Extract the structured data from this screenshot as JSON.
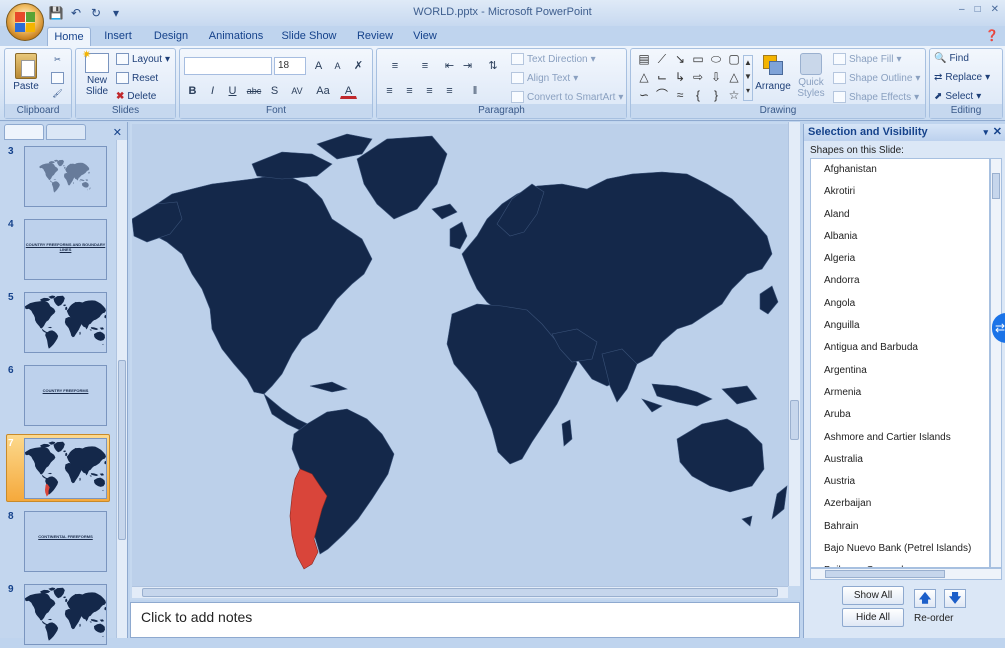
{
  "window": {
    "title": "WORLD.pptx - Microsoft PowerPoint"
  },
  "tabs": [
    "Home",
    "Insert",
    "Design",
    "Animations",
    "Slide Show",
    "Review",
    "View"
  ],
  "ribbon": {
    "clipboard": {
      "label": "Clipboard",
      "paste": "Paste"
    },
    "slides": {
      "label": "Slides",
      "new_slide": "New Slide",
      "new_slide_l1": "New",
      "new_slide_l2": "Slide",
      "layout": "Layout",
      "reset": "Reset",
      "delete": "Delete"
    },
    "font": {
      "label": "Font",
      "font_name": "",
      "font_size": "18",
      "bold": "B",
      "italic": "I",
      "underline": "U",
      "strike": "abc",
      "shadow": "S",
      "spacing": "AV",
      "case": "Aa",
      "color": "A",
      "grow": "A",
      "shrink": "A"
    },
    "paragraph": {
      "label": "Paragraph",
      "text_direction": "Text Direction",
      "align_text": "Align Text",
      "convert_smartart": "Convert to SmartArt"
    },
    "drawing": {
      "label": "Drawing",
      "arrange": "Arrange",
      "quick_styles": "Quick Styles",
      "quick_styles_l1": "Quick",
      "quick_styles_l2": "Styles",
      "shape_fill": "Shape Fill",
      "shape_outline": "Shape Outline",
      "shape_effects": "Shape Effects"
    },
    "editing": {
      "label": "Editing",
      "find": "Find",
      "replace": "Replace",
      "select": "Select"
    }
  },
  "slides_panel": {
    "thumbnails": [
      {
        "num": "3",
        "type": "map-small",
        "text": "",
        "selected": false
      },
      {
        "num": "4",
        "type": "text",
        "text": "COUNTRY FREEFORMS AND BOUNDARY LINES",
        "selected": false
      },
      {
        "num": "5",
        "type": "map",
        "text": "",
        "selected": false
      },
      {
        "num": "6",
        "type": "text",
        "text": "COUNTRY FREEFORMS",
        "selected": false
      },
      {
        "num": "7",
        "type": "map-highlight",
        "text": "",
        "selected": true
      },
      {
        "num": "8",
        "type": "text",
        "text": "CONTINENTAL FREEFORMS",
        "selected": false
      },
      {
        "num": "9",
        "type": "map",
        "text": "",
        "selected": false
      }
    ]
  },
  "notes": {
    "placeholder": "Click to add notes"
  },
  "selection_pane": {
    "title": "Selection and Visibility",
    "subtitle": "Shapes on this Slide:",
    "items": [
      "Afghanistan",
      "Akrotiri",
      "Aland",
      "Albania",
      "Algeria",
      "Andorra",
      "Angola",
      "Anguilla",
      "Antigua and Barbuda",
      "Argentina",
      "Armenia",
      "Aruba",
      "Ashmore and Cartier Islands",
      "Australia",
      "Austria",
      "Azerbaijan",
      "Bahrain",
      "Bajo Nuevo Bank (Petrel Islands)",
      "Baikonur Cosmodrome"
    ],
    "show_all": "Show All",
    "hide_all": "Hide All",
    "reorder": "Re-order"
  },
  "colors": {
    "map_land": "#14284a",
    "map_ocean": "#bcd0ea",
    "highlight": "#d9453a",
    "selected_thumb": "#f5a93c"
  }
}
